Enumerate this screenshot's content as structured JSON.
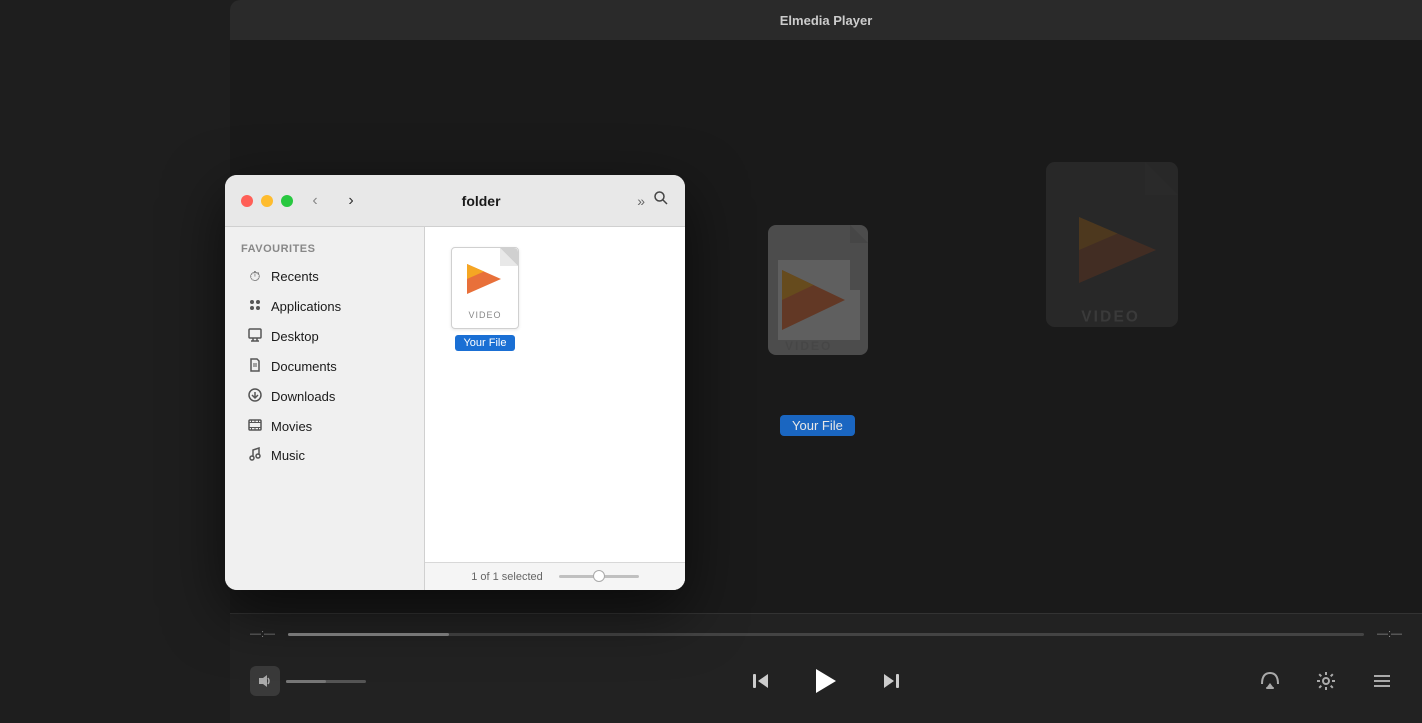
{
  "player": {
    "title": "Elmedia Player",
    "background_color": "#1a1a1a",
    "progress_left": "—:—",
    "progress_right": "—:—"
  },
  "finder": {
    "title": "folder",
    "status_text": "1 of 1 selected",
    "file": {
      "name": "Your File",
      "type_label": "VIDEO"
    }
  },
  "sidebar": {
    "section_label": "Favourites",
    "items": [
      {
        "label": "Recents",
        "icon": "🕐"
      },
      {
        "label": "Applications",
        "icon": "✦"
      },
      {
        "label": "Desktop",
        "icon": "🖥"
      },
      {
        "label": "Documents",
        "icon": "📄"
      },
      {
        "label": "Downloads",
        "icon": "⬇"
      },
      {
        "label": "Movies",
        "icon": "📽"
      },
      {
        "label": "Music",
        "icon": "♪"
      }
    ]
  },
  "controls": {
    "prev_label": "⏮",
    "play_label": "▶",
    "next_label": "⏭",
    "airplay_label": "⊙",
    "settings_label": "⚙",
    "playlist_label": "☰"
  }
}
